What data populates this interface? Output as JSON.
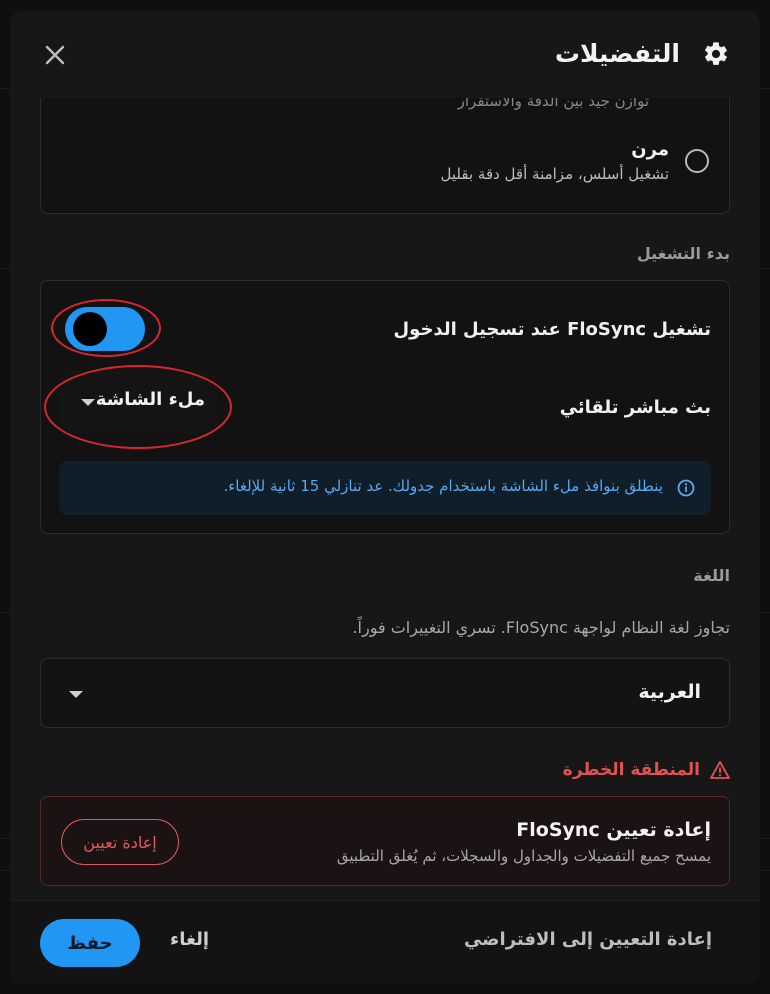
{
  "dialog": {
    "title": "التفضيلات",
    "icons": {
      "title": "gear-icon",
      "close": "close-icon"
    }
  },
  "sync_mode": {
    "cutoff_text": "توازن جيد بين الدقة والاستقرار",
    "option": {
      "title": "مرن",
      "description": "تشغيل أسلس، مزامنة أقل دقة بقليل",
      "selected": false
    }
  },
  "startup": {
    "section_label": "بدء التشغيل",
    "autostart_label": "تشغيل FloSync عند تسجيل الدخول",
    "autostart_enabled": true,
    "autocast_label": "بث مباشر تلقائي",
    "autocast_value": "ملء الشاشة",
    "info_text": "ينطلق بنوافذ ملء الشاشة باستخدام جدولك. عد تنازلي 15 ثانية للإلغاء."
  },
  "language": {
    "section_label": "اللغة",
    "hint": "تجاوز لغة النظام لواجهة FloSync. تسري التغييرات فوراً.",
    "value": "العربية"
  },
  "danger_zone": {
    "section_label": "المنطقة الخطرة",
    "title": "إعادة تعيين FloSync",
    "description": "يمسح جميع التفضيلات والجداول والسجلات، ثم يُغلق التطبيق",
    "reset_button": "إعادة تعيين"
  },
  "footer": {
    "save": "حفظ",
    "cancel": "إلغاء",
    "reset_default": "إعادة التعيين إلى الافتراضي"
  },
  "colors": {
    "accent": "#2196f3",
    "danger": "#e05252",
    "annotation": "#d8262e"
  }
}
